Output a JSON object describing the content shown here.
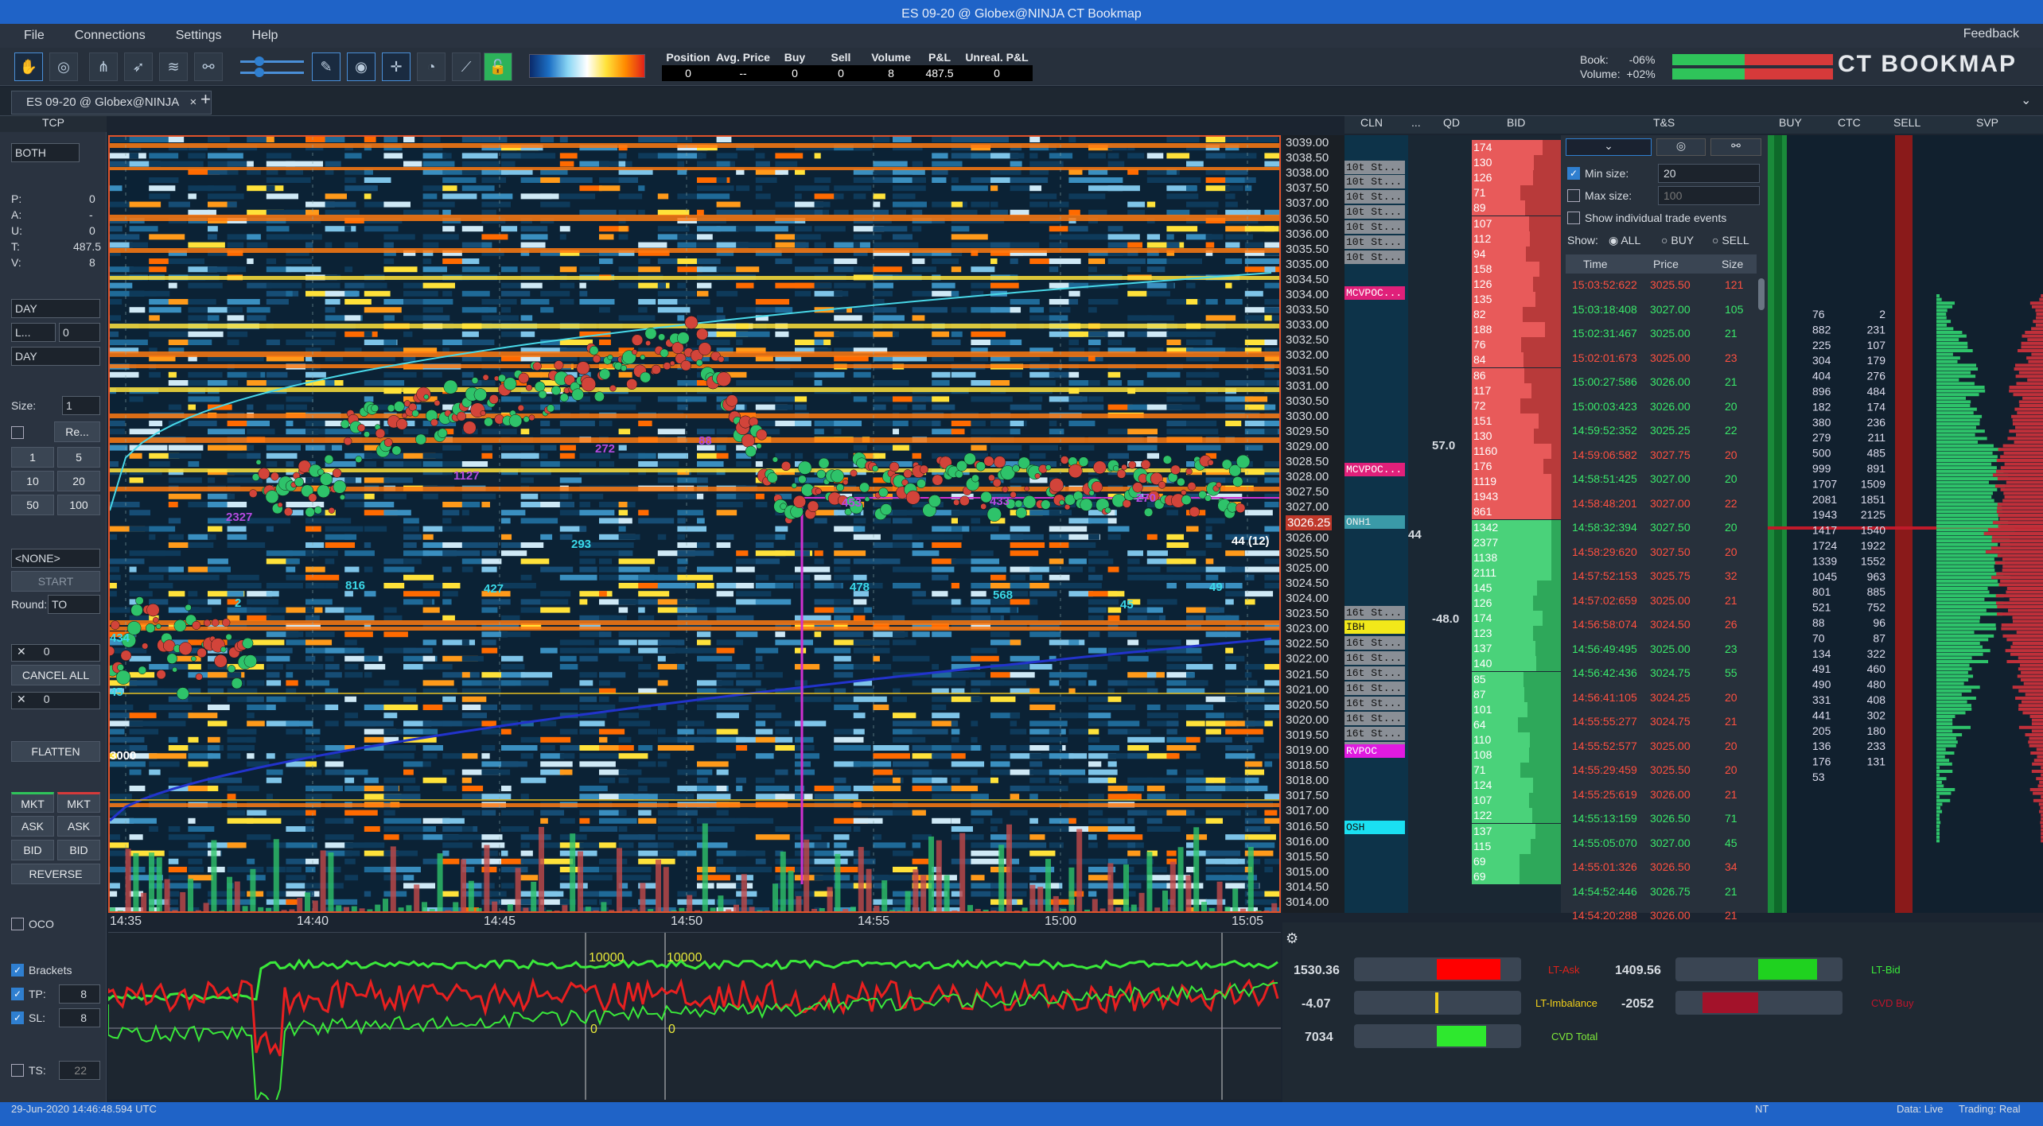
{
  "window": {
    "title": "ES 09-20 @ Globex@NINJA       CT Bookmap"
  },
  "menu": {
    "items": [
      "File",
      "Connections",
      "Settings",
      "Help"
    ],
    "feedback": "Feedback"
  },
  "pnl": {
    "headers": [
      "Position",
      "Avg. Price",
      "Buy",
      "Sell",
      "Volume",
      "P&L",
      "Unreal. P&L"
    ],
    "values": [
      "0",
      "--",
      "0",
      "0",
      "8",
      "487.5",
      "0"
    ]
  },
  "book": {
    "book_label": "Book:",
    "book_value": "-06%",
    "volume_label": "Volume:",
    "volume_value": "+02%",
    "brand": "CT BOOKMAP"
  },
  "tab": {
    "label": "ES 09-20 @ Globex@NINJA"
  },
  "left": {
    "tcp": "TCP",
    "both": "BOTH",
    "p": "P:",
    "p_v": "0",
    "a": "A:",
    "a_v": "-",
    "u": "U:",
    "u_v": "0",
    "t": "T:",
    "t_v": "487.5",
    "v": "V:",
    "v_v": "8",
    "day1": "DAY",
    "l": "L...",
    "l_v": "0",
    "day2": "DAY",
    "size": "Size:",
    "size_v": "1",
    "re": "Re...",
    "q1": "1",
    "q5": "5",
    "q10": "10",
    "q20": "20",
    "q50": "50",
    "q100": "100",
    "none": "<NONE>",
    "start": "START",
    "round": "Round:",
    "round_v": "TO",
    "cancel_v": "0",
    "cancel_all": "CANCEL ALL",
    "close_v": "0",
    "flatten": "FLATTEN",
    "mkt": "MKT",
    "ask": "ASK",
    "bid": "BID",
    "reverse": "REVERSE",
    "oco": "OCO",
    "brackets": "Brackets",
    "tp": "TP:",
    "tp_v": "8",
    "sl": "SL:",
    "sl_v": "8",
    "ts": "TS:",
    "ts_v": "22"
  },
  "prices": [
    "3039.00",
    "3038.50",
    "3038.00",
    "3037.50",
    "3037.00",
    "3036.50",
    "3036.00",
    "3035.50",
    "3035.00",
    "3034.50",
    "3034.00",
    "3033.50",
    "3033.00",
    "3032.50",
    "3032.00",
    "3031.50",
    "3031.00",
    "3030.50",
    "3030.00",
    "3029.50",
    "3029.00",
    "3028.50",
    "3028.00",
    "3027.50",
    "3027.00",
    "3026.25",
    "3026.00",
    "3025.50",
    "3025.00",
    "3024.50",
    "3024.00",
    "3023.50",
    "3023.00",
    "3022.50",
    "3022.00",
    "3021.50",
    "3021.00",
    "3020.50",
    "3020.00",
    "3019.50",
    "3019.00",
    "3018.50",
    "3018.00",
    "3017.50",
    "3017.00",
    "3016.50",
    "3016.00",
    "3015.50",
    "3015.00",
    "3014.50",
    "3014.00"
  ],
  "time_axis": [
    "14:35",
    "14:40",
    "14:45",
    "14:50",
    "14:55",
    "15:00",
    "15:05"
  ],
  "chart_labels": [
    "2327",
    "1127",
    "272",
    "816",
    "293",
    "427",
    "88",
    "478",
    "568",
    "453",
    "433",
    "270",
    "45",
    "49",
    "2",
    "45",
    "434",
    "3000",
    "44 (12)"
  ],
  "headers": {
    "cln": "CLN",
    "dots": "...",
    "qd": "QD",
    "bid": "BID",
    "ts": "T&S",
    "buy": "BUY",
    "ctc": "CTC",
    "sell": "SELL",
    "svp": "SVP"
  },
  "cln_labels": [
    "10t St...",
    "10t St...",
    "10t St...",
    "10t St...",
    "10t St...",
    "10t St...",
    "10t St...",
    "MCVPOC...",
    "MCVPOC...",
    "ONH1",
    "16t St...",
    "IBH",
    "16t St...",
    "16t St...",
    "16t St...",
    "16t St...",
    "16t St...",
    "16t St...",
    "16t St...",
    "16t St...",
    "RVPOC",
    "OSH"
  ],
  "qd_labels": [
    "57.0",
    "44",
    "-48.0"
  ],
  "bid_values": [
    "174",
    "130",
    "126",
    "71",
    "89",
    "107",
    "112",
    "94",
    "158",
    "126",
    "135",
    "82",
    "188",
    "76",
    "84",
    "86",
    "117",
    "72",
    "151",
    "130",
    "1160",
    "176",
    "1119",
    "1943",
    "861",
    "1342",
    "2377",
    "1138",
    "2111",
    "145",
    "126",
    "174",
    "123",
    "137",
    "140",
    "85",
    "87",
    "101",
    "64",
    "110",
    "108",
    "71",
    "124",
    "107",
    "122",
    "137",
    "115",
    "69",
    "69"
  ],
  "ts": {
    "min_size_label": "Min size:",
    "min_size": "20",
    "max_size_label": "Max size:",
    "max_size": "100",
    "show_individual": "Show individual trade events",
    "show": "Show:",
    "all": "ALL",
    "buy": "BUY",
    "sell": "SELL",
    "col_time": "Time",
    "col_price": "Price",
    "col_size": "Size",
    "rows": [
      {
        "time": "15:03:52:622",
        "price": "3025.50",
        "size": "121",
        "side": "sell"
      },
      {
        "time": "15:03:18:408",
        "price": "3027.00",
        "size": "105",
        "side": "buy"
      },
      {
        "time": "15:02:31:467",
        "price": "3025.00",
        "size": "21",
        "side": "buy"
      },
      {
        "time": "15:02:01:673",
        "price": "3025.00",
        "size": "23",
        "side": "sell"
      },
      {
        "time": "15:00:27:586",
        "price": "3026.00",
        "size": "21",
        "side": "buy"
      },
      {
        "time": "15:00:03:423",
        "price": "3026.00",
        "size": "20",
        "side": "buy"
      },
      {
        "time": "14:59:52:352",
        "price": "3025.25",
        "size": "22",
        "side": "buy"
      },
      {
        "time": "14:59:06:582",
        "price": "3027.75",
        "size": "20",
        "side": "sell"
      },
      {
        "time": "14:58:51:425",
        "price": "3027.00",
        "size": "20",
        "side": "buy"
      },
      {
        "time": "14:58:48:201",
        "price": "3027.00",
        "size": "22",
        "side": "sell"
      },
      {
        "time": "14:58:32:394",
        "price": "3027.50",
        "size": "20",
        "side": "buy"
      },
      {
        "time": "14:58:29:620",
        "price": "3027.50",
        "size": "20",
        "side": "sell"
      },
      {
        "time": "14:57:52:153",
        "price": "3025.75",
        "size": "32",
        "side": "sell"
      },
      {
        "time": "14:57:02:659",
        "price": "3025.00",
        "size": "21",
        "side": "sell"
      },
      {
        "time": "14:56:58:074",
        "price": "3024.50",
        "size": "26",
        "side": "sell"
      },
      {
        "time": "14:56:49:495",
        "price": "3025.00",
        "size": "23",
        "side": "buy"
      },
      {
        "time": "14:56:42:436",
        "price": "3024.75",
        "size": "55",
        "side": "buy"
      },
      {
        "time": "14:56:41:105",
        "price": "3024.25",
        "size": "20",
        "side": "sell"
      },
      {
        "time": "14:55:55:277",
        "price": "3024.75",
        "size": "21",
        "side": "sell"
      },
      {
        "time": "14:55:52:577",
        "price": "3025.00",
        "size": "20",
        "side": "sell"
      },
      {
        "time": "14:55:29:459",
        "price": "3025.50",
        "size": "20",
        "side": "sell"
      },
      {
        "time": "14:55:25:619",
        "price": "3026.00",
        "size": "21",
        "side": "sell"
      },
      {
        "time": "14:55:13:159",
        "price": "3026.50",
        "size": "71",
        "side": "buy"
      },
      {
        "time": "14:55:05:070",
        "price": "3027.00",
        "size": "45",
        "side": "buy"
      },
      {
        "time": "14:55:01:326",
        "price": "3026.50",
        "size": "34",
        "side": "sell"
      },
      {
        "time": "14:54:52:446",
        "price": "3026.75",
        "size": "21",
        "side": "buy"
      },
      {
        "time": "14:54:20:288",
        "price": "3026.00",
        "size": "21",
        "side": "sell"
      }
    ]
  },
  "ctc": {
    "left": [
      "76",
      "882",
      "225",
      "304",
      "404",
      "896",
      "182",
      "380",
      "279",
      "500",
      "999",
      "1707",
      "2081",
      "1943",
      "1417",
      "1724",
      "1339",
      "1045",
      "801",
      "521",
      "88",
      "70",
      "134",
      "491",
      "490",
      "331",
      "441",
      "205",
      "136",
      "176",
      "53"
    ],
    "right": [
      "2",
      "231",
      "107",
      "179",
      "276",
      "484",
      "174",
      "236",
      "211",
      "485",
      "891",
      "1509",
      "1851",
      "2125",
      "1540",
      "1922",
      "1552",
      "963",
      "885",
      "752",
      "96",
      "87",
      "322",
      "460",
      "480",
      "408",
      "302",
      "180",
      "233",
      "131"
    ]
  },
  "cvd": {
    "v1": "1530.36",
    "l1": "LT-Ask",
    "v2": "1409.56",
    "l2": "LT-Bid",
    "v3": "-4.07",
    "l3": "LT-Imbalance",
    "v4": "-2052",
    "l4": "CVD Buy",
    "v5": "7034",
    "l5": "CVD Total"
  },
  "indicator_labels": [
    "10000",
    "10000",
    "0",
    "0"
  ],
  "status": {
    "datetime": "29-Jun-2020 14:46:48.594 UTC",
    "nt": "NT",
    "data": "Data: Live",
    "trading": "Trading: Real"
  }
}
